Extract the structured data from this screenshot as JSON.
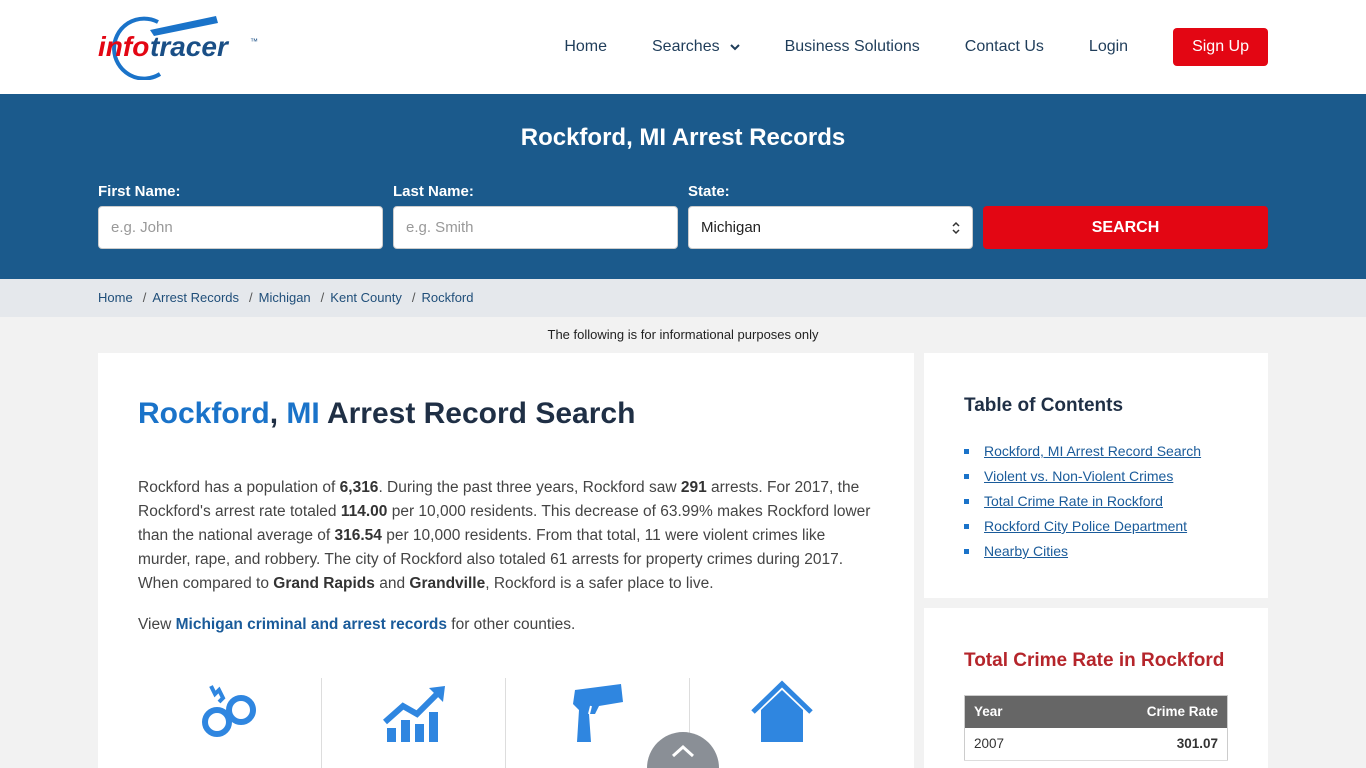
{
  "brand": {
    "logo_part1": "info",
    "logo_part2": "tracer",
    "tm": "™",
    "accent": "#e30613",
    "blue": "#1b5a8c"
  },
  "nav": {
    "home": "Home",
    "searches": "Searches",
    "business": "Business Solutions",
    "contact": "Contact Us",
    "login": "Login",
    "signup": "Sign Up"
  },
  "hero": {
    "title": "Rockford, MI Arrest Records",
    "first_name_label": "First Name:",
    "first_name_placeholder": "e.g. John",
    "last_name_label": "Last Name:",
    "last_name_placeholder": "e.g. Smith",
    "state_label": "State:",
    "state_value": "Michigan",
    "search_label": "SEARCH"
  },
  "breadcrumb": [
    "Home",
    "Arrest Records",
    "Michigan",
    "Kent County",
    "Rockford"
  ],
  "info_note": "The following is for informational purposes only",
  "main": {
    "title_city": "Rockford",
    "title_comma": ",",
    "title_state": "MI",
    "title_rest": "Arrest Record Search",
    "intro": {
      "t1": "Rockford has a population of ",
      "population": "6,316",
      "t2": ". During the past three years, Rockford saw ",
      "arrests": "291",
      "t3": " arrests. For 2017, the Rockford's arrest rate totaled ",
      "rate": "114.00",
      "t4": " per 10,000 residents. This decrease of 63.99% makes Rockford lower than the national average of ",
      "national": "316.54",
      "t5": " per 10,000 residents. From that total, 11 were violent crimes like murder, rape, and robbery. The city of Rockford also totaled 61 arrests for property crimes during 2017. When compared to ",
      "city1": "Grand Rapids",
      "t6": " and ",
      "city2": "Grandville",
      "t7": ", Rockford is a safer place to live."
    },
    "view_prefix": "View ",
    "view_link": "Michigan criminal and arrest records",
    "view_suffix": " for other counties.",
    "icons": [
      "handcuffs-icon",
      "chart-up-icon",
      "gun-icon",
      "house-icon"
    ]
  },
  "toc": {
    "title": "Table of Contents",
    "items": [
      "Rockford, MI Arrest Record Search",
      "Violent vs. Non-Violent Crimes",
      "Total Crime Rate in Rockford",
      "Rockford City Police Department",
      "Nearby Cities"
    ]
  },
  "rate": {
    "title": "Total Crime Rate in Rockford",
    "col_year": "Year",
    "col_rate": "Crime Rate",
    "rows": [
      {
        "year": "2007",
        "rate": "301.07"
      }
    ]
  }
}
